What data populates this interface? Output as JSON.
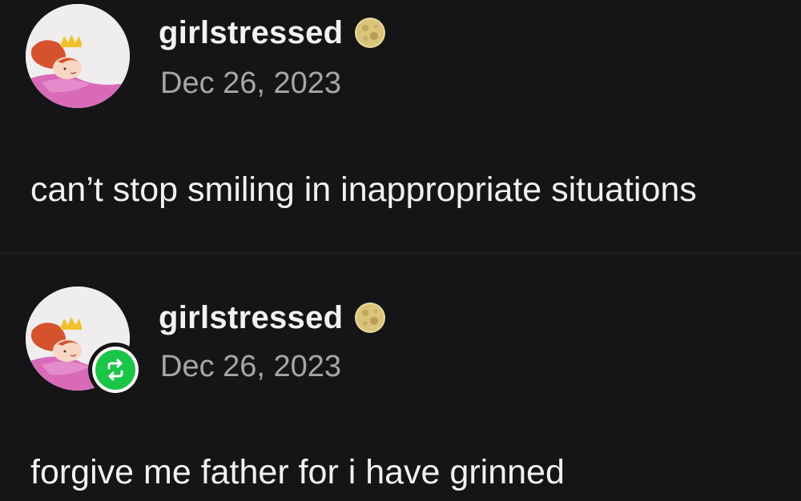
{
  "posts": [
    {
      "username": "girlstressed",
      "badge_icon": "full-moon-icon",
      "date": "Dec 26, 2023",
      "text": "can’t stop smiling in inappropriate situations",
      "reblogged": false
    },
    {
      "username": "girlstressed",
      "badge_icon": "full-moon-icon",
      "date": "Dec 26, 2023",
      "text": "forgive me father for i have grinned",
      "reblogged": true,
      "reblog_icon": "reblog-icon"
    }
  ],
  "colors": {
    "background": "#151517",
    "text": "#f1f1f1",
    "date": "#a6a6a6",
    "reblog_green": "#1bc547"
  }
}
